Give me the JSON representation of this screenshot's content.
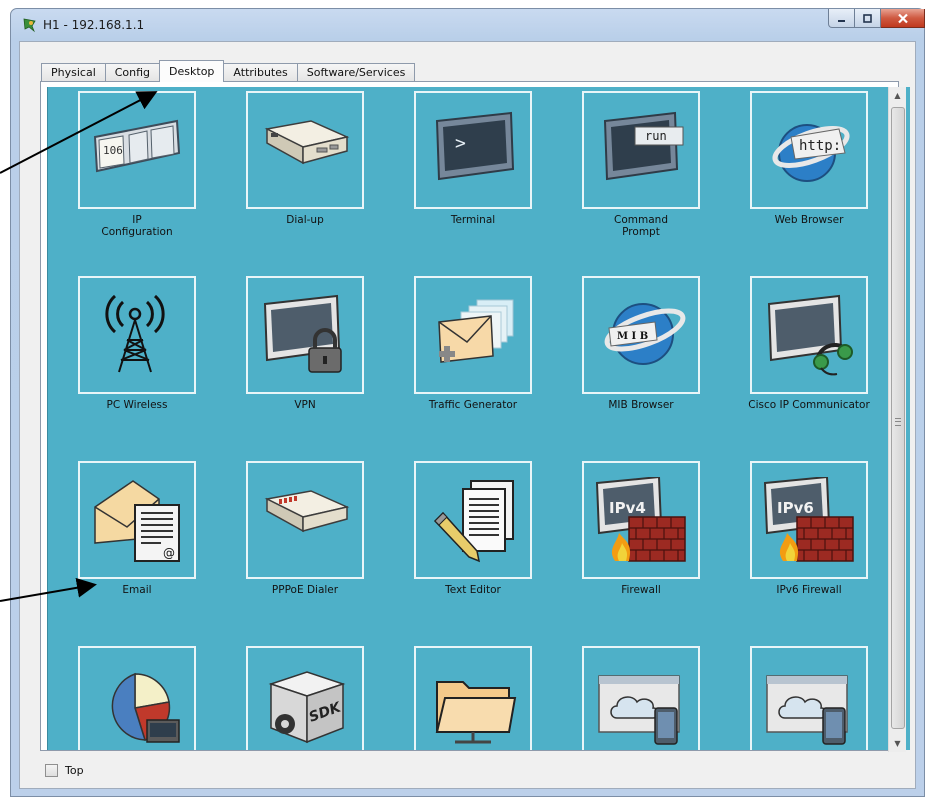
{
  "window": {
    "title": "H1 - 192.168.1.1"
  },
  "tabs": [
    {
      "label": "Physical",
      "active": false
    },
    {
      "label": "Config",
      "active": false
    },
    {
      "label": "Desktop",
      "active": true
    },
    {
      "label": "Attributes",
      "active": false
    },
    {
      "label": "Software/Services",
      "active": false
    }
  ],
  "apps": [
    {
      "label": "IP\nConfiguration",
      "icon": "ip-configuration-icon"
    },
    {
      "label": "Dial-up",
      "icon": "dial-up-icon"
    },
    {
      "label": "Terminal",
      "icon": "terminal-icon"
    },
    {
      "label": "Command\nPrompt",
      "icon": "command-prompt-icon"
    },
    {
      "label": "Web Browser",
      "icon": "web-browser-icon"
    },
    {
      "label": "PC Wireless",
      "icon": "pc-wireless-icon"
    },
    {
      "label": "VPN",
      "icon": "vpn-icon"
    },
    {
      "label": "Traffic Generator",
      "icon": "traffic-generator-icon"
    },
    {
      "label": "MIB Browser",
      "icon": "mib-browser-icon"
    },
    {
      "label": "Cisco IP Communicator",
      "icon": "cisco-ip-communicator-icon"
    },
    {
      "label": "Email",
      "icon": "email-icon"
    },
    {
      "label": "PPPoE Dialer",
      "icon": "pppoe-dialer-icon"
    },
    {
      "label": "Text Editor",
      "icon": "text-editor-icon"
    },
    {
      "label": "Firewall",
      "icon": "firewall-icon"
    },
    {
      "label": "IPv6 Firewall",
      "icon": "ipv6-firewall-icon"
    },
    {
      "label": "",
      "icon": "netflow-collector-icon"
    },
    {
      "label": "",
      "icon": "sdk-icon"
    },
    {
      "label": "",
      "icon": "file-manager-icon"
    },
    {
      "label": "",
      "icon": "iot-monitor-icon"
    },
    {
      "label": "",
      "icon": "iot-monitor-icon"
    }
  ],
  "icon_text": {
    "ip_config_number": "106",
    "terminal_prompt": ">",
    "command": "run",
    "web": "http:",
    "mib": "M I B",
    "ipv4": "IPv4",
    "ipv6": "IPv6",
    "email_at": "@",
    "sdk": "SDK"
  },
  "footer": {
    "top_checkbox_label": "Top",
    "top_checked": false
  },
  "colors": {
    "desktop_background": "#4eb0c8",
    "close_button": "#c9462b"
  }
}
